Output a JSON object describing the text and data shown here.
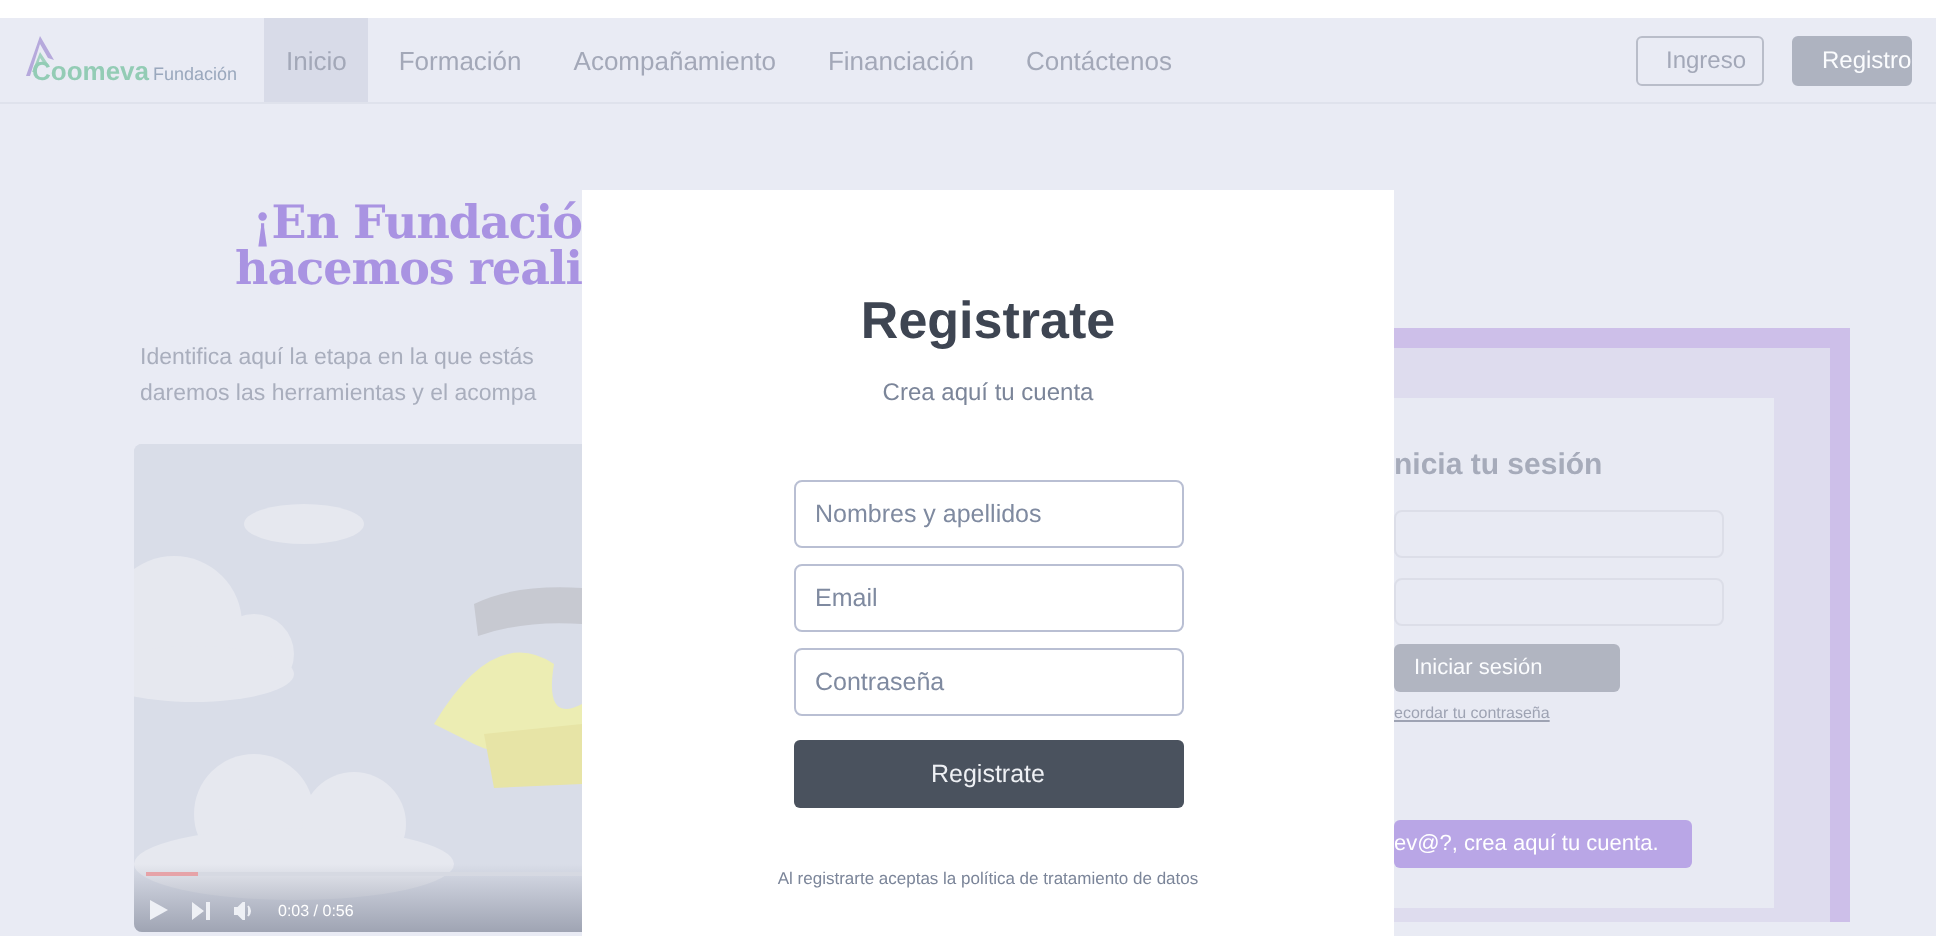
{
  "header": {
    "logo": {
      "brand": "Coomeva",
      "suffix": "Fundación"
    },
    "nav": [
      {
        "label": "Inicio",
        "selected": true
      },
      {
        "label": "Formación",
        "selected": false
      },
      {
        "label": "Acompañamiento",
        "selected": false
      },
      {
        "label": "Financiación",
        "selected": false
      },
      {
        "label": "Contáctenos",
        "selected": false
      }
    ],
    "buttons": [
      {
        "label": "Ingreso",
        "kind": "outline"
      },
      {
        "label": "Registro",
        "kind": "filled"
      }
    ]
  },
  "hero": {
    "title_lines": [
      "¡En Fundació",
      "hacemos reali"
    ],
    "intro_lines": [
      "Identifica aquí la etapa en la que estás",
      "daremos las herramientas y el acompa"
    ],
    "video": {
      "kind": "picture",
      "time": "0:03 / 0:56",
      "level": 0.12
    }
  },
  "login": {
    "title": "nicia tu sesión",
    "button": "Iniciar sesión",
    "link": "ecordar tu contraseña",
    "signup": "ev@?, crea aquí tu cuenta."
  },
  "modal": {
    "title": "Registrate",
    "subtitle": "Crea aquí tu cuenta",
    "fields": [
      {
        "placeholder": "Nombres y apellidos"
      },
      {
        "placeholder": "Email"
      },
      {
        "placeholder": "Contraseña"
      }
    ],
    "submit": "Registrate",
    "footer": "Al registrarte aceptas la política de tratamiento de datos"
  }
}
